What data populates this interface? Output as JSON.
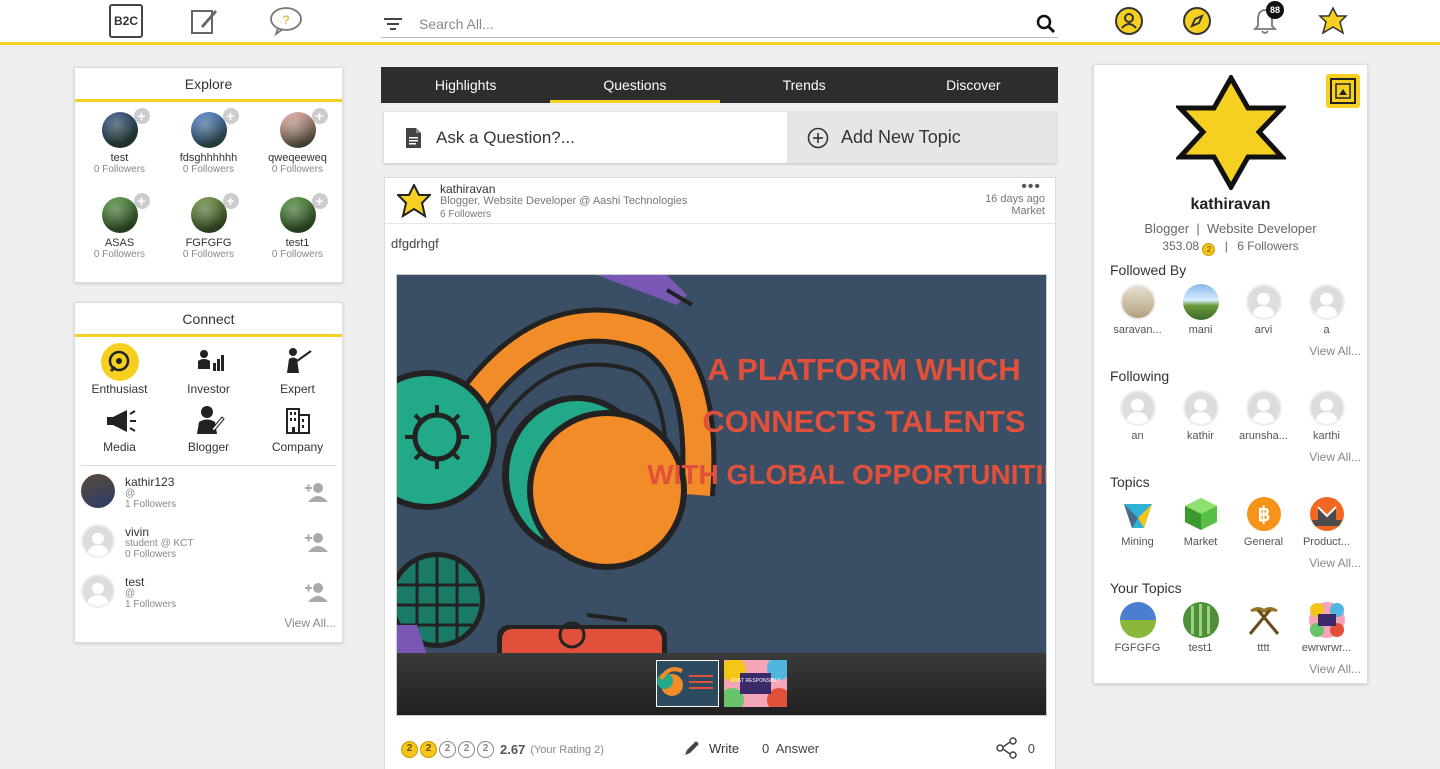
{
  "topbar": {
    "logo_label": "B2C",
    "search_placeholder": "Search All...",
    "notification_count": "88"
  },
  "explore": {
    "title": "Explore",
    "items": [
      {
        "name": "test",
        "followers": "0 Followers",
        "color": "#2b4a7a"
      },
      {
        "name": "fdsghhhhhh",
        "followers": "0 Followers",
        "color": "#4a7ed0"
      },
      {
        "name": "qweqeeweq",
        "followers": "0 Followers",
        "color": "#e9a7a0"
      },
      {
        "name": "ASAS",
        "followers": "0 Followers",
        "color": "#4f8f3a"
      },
      {
        "name": "FGFGFG",
        "followers": "0 Followers",
        "color": "#6a8f3a"
      },
      {
        "name": "test1",
        "followers": "0 Followers",
        "color": "#4f8f3a"
      }
    ]
  },
  "connect": {
    "title": "Connect",
    "categories": [
      {
        "label": "Enthusiast",
        "icon": "enthusiast-icon"
      },
      {
        "label": "Investor",
        "icon": "investor-icon"
      },
      {
        "label": "Expert",
        "icon": "expert-icon"
      },
      {
        "label": "Media",
        "icon": "media-icon"
      },
      {
        "label": "Blogger",
        "icon": "blogger-icon"
      },
      {
        "label": "Company",
        "icon": "company-icon"
      }
    ],
    "people": [
      {
        "name": "kathir123",
        "sub": "@",
        "followers": "1 Followers"
      },
      {
        "name": "vivin",
        "sub": "student @ KCT",
        "followers": "0 Followers"
      },
      {
        "name": "test",
        "sub": "@",
        "followers": "1 Followers"
      }
    ],
    "view_all": "View All..."
  },
  "tabs": [
    "Highlights",
    "Questions",
    "Trends",
    "Discover"
  ],
  "ask": {
    "question_label": "Ask a Question?...",
    "topic_label": "Add New Topic"
  },
  "post": {
    "author": "kathiravan",
    "role": "Blogger, Website Developer @ Aashi Technologies",
    "followers": "6 Followers",
    "time": "16 days ago",
    "topic": "Market",
    "title": "dfgdrhgf",
    "banner_lines": [
      "A PLATFORM WHICH",
      "CONNECTS TALENTS",
      "WITH GLOBAL OPPORTUNITIES"
    ],
    "thumb2_text": "POST RESPONSIBLY",
    "rating": "2.67",
    "your_rating": "(Your Rating 2)",
    "write_label": "Write",
    "answer_label": "0  Answer",
    "share_count": "0"
  },
  "profile": {
    "name": "kathiravan",
    "role": "Blogger  |  Website Developer",
    "points": "353.08",
    "followers": "6 Followers",
    "followed_by_title": "Followed By",
    "followed_by": [
      "saravan...",
      "mani",
      "arvi",
      "a"
    ],
    "following_title": "Following",
    "following": [
      "an",
      "kathir",
      "arunsha...",
      "karthi"
    ],
    "topics_title": "Topics",
    "topics": [
      "Mining",
      "Market",
      "General",
      "Product..."
    ],
    "your_topics_title": "Your Topics",
    "your_topics": [
      "FGFGFG",
      "test1",
      "tttt",
      "ewrwrwr..."
    ],
    "view_all": "View All..."
  }
}
